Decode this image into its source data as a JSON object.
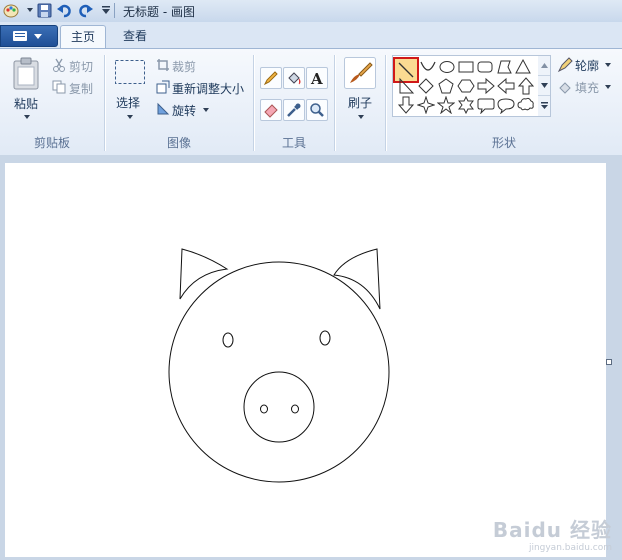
{
  "title_bar": {
    "title": "无标题 - 画图"
  },
  "tabs": [
    {
      "label": "主页",
      "active": true
    },
    {
      "label": "查看",
      "active": false
    }
  ],
  "clipboard_group": {
    "label": "剪贴板",
    "paste": "粘贴",
    "cut": "剪切",
    "copy": "复制"
  },
  "image_group": {
    "label": "图像",
    "select": "选择",
    "crop": "裁剪",
    "resize": "重新调整大小",
    "rotate": "旋转"
  },
  "tools_group": {
    "label": "工具"
  },
  "brushes": {
    "label": "刷子"
  },
  "shapes_group": {
    "label": "形状",
    "outline": "轮廓",
    "fill": "填充",
    "selected_shape": "line",
    "items": [
      "line",
      "curve",
      "oval",
      "rectangle",
      "rounded-rectangle",
      "polygon",
      "triangle",
      "right-triangle",
      "diamond",
      "pentagon",
      "hexagon",
      "right-arrow",
      "left-arrow",
      "up-arrow",
      "down-arrow",
      "four-point-star",
      "five-point-star",
      "six-point-star",
      "rounded-callout",
      "oval-callout",
      "cloud-callout"
    ]
  },
  "watermark": {
    "line1": "Baidu 经验",
    "line2": "jingyan.baidu.com"
  },
  "colors": {
    "ribbon": "#e1eaf6",
    "workspace": "#c9d6e6",
    "selection": "#d01818",
    "app_button": "#2b5ea4"
  }
}
